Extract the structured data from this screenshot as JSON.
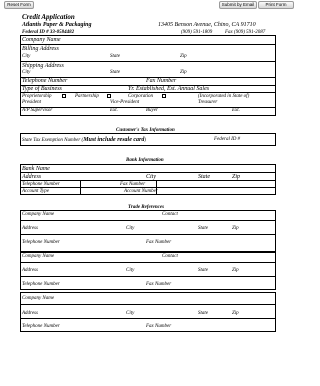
{
  "toolbar": {
    "reset_label": "Reset Form",
    "submit_label": "Submit by Email",
    "print_label": "Print Form"
  },
  "header": {
    "title": "Credit Application",
    "company": "Atlantis Paper & Packaging",
    "federal_id": "Federal ID # 33-0584482",
    "address": "13405 Benson Avenue, Chino, CA 91710",
    "phone": "(909) 591-1809",
    "fax": "Fax (909) 591-2087"
  },
  "applicant": {
    "company_name": "Company Name",
    "billing_address": "Billing Address",
    "shipping_address": "Shipping Address",
    "city": "City",
    "state": "State",
    "zip": "Zip",
    "telephone_number": "Telephone Number",
    "fax_number": "Fax Number",
    "type_of_business": "Type of Business",
    "yr_established": "Yr. Established, Est. Annual Sales",
    "proprietorship": "Proprietorship",
    "partnership": "Partnership",
    "corporation": "Corporation",
    "incorporated_in": "(Incorporated in State of)",
    "president": "President",
    "vice_president": "Vice-President",
    "treasurer": "Treasurer",
    "ap_supervisor": "A/P Supervisor",
    "ext": "Ext.",
    "buyer": "Buyer"
  },
  "tax": {
    "heading": "Customer's Tax Information",
    "exemption_label": "State Tax Exemption Number (",
    "exemption_bold": "Must include resale card",
    "exemption_close": ")",
    "federal_id": "Federal ID #"
  },
  "bank": {
    "heading": "Bank Information",
    "bank_name": "Bank Name",
    "address": "Address",
    "city": "City",
    "state": "State",
    "zip": "Zip",
    "telephone_number": "Telephone Number",
    "fax_number": "Fax Number",
    "account_type": "Account Type",
    "account_number": "Account Number"
  },
  "trade": {
    "heading": "Trade References",
    "company_name": "Company Name",
    "contact": "Contact",
    "address": "Address",
    "city": "City",
    "state": "State",
    "zip": "Zip",
    "telephone_number": "Telephone Number",
    "fax_number": "Fax Number"
  }
}
